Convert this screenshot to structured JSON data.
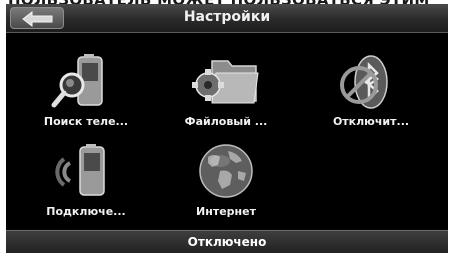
{
  "caption_fragment": "ПОЛЬЗОВАТЕЛЬ МОЖЕТ ПОЛЬЗОВАТЬСЯ ЭТИМ",
  "header": {
    "title": "Настройки",
    "back_icon": "back-arrow-icon"
  },
  "tiles": [
    {
      "label": "Поиск теле...",
      "icon": "phone-search-icon"
    },
    {
      "label": "Файловый ...",
      "icon": "folder-gear-icon"
    },
    {
      "label": "Отключит...",
      "icon": "bluetooth-disabled-icon"
    },
    {
      "label": "Подключе...",
      "icon": "phone-connect-icon"
    },
    {
      "label": "Интернет",
      "icon": "globe-icon"
    }
  ],
  "status": {
    "text": "Отключено"
  }
}
